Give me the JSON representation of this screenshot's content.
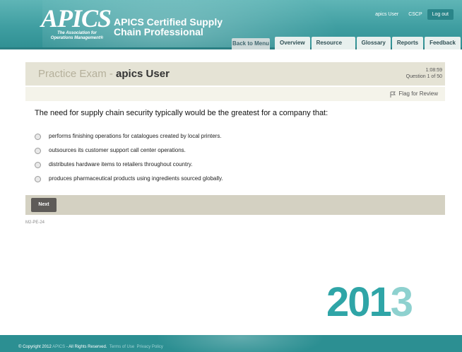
{
  "header": {
    "logo_word": "APICS",
    "logo_tagline_1": "The Association for",
    "logo_tagline_2": "Operations Management®",
    "product_line_1": "APICS Certified Supply",
    "product_line_2": "Chain Professional",
    "user_link": "apics User",
    "cscp_link": "CSCP",
    "logout_label": "Log out",
    "back_label": "Back to Menu",
    "tabs": [
      "Overview",
      "Resource Center",
      "Glossary",
      "Reports",
      "Feedback"
    ]
  },
  "exam": {
    "title_prefix": "Practice Exam - ",
    "user_name": "apics User",
    "timer": "1:08:59",
    "progress": "Question 1 of 50",
    "flag_label": "Flag for Review"
  },
  "question": {
    "text": "The need for supply chain security typically would be the greatest for a company that:",
    "answers": [
      "performs finishing operations for catalogues created by local printers.",
      "outsources its customer support call center operations.",
      "distributes hardware items to retailers throughout country.",
      "produces pharmaceutical products using ingredients sourced globally."
    ]
  },
  "next_label": "Next",
  "question_code": "M2-PE-24",
  "year": {
    "solid": "201",
    "ghost": "3"
  },
  "footer": {
    "copyright": "© Copyright 2012",
    "apics": "APICS",
    "rights": "- All Rights Reserved.",
    "terms": "Terms of Use",
    "privacy": "Privacy Policy"
  },
  "colors": {
    "brand_teal": "#3f9ea1",
    "footer_teal": "#2c8f92",
    "exam_bar": "#e5e3d5"
  }
}
